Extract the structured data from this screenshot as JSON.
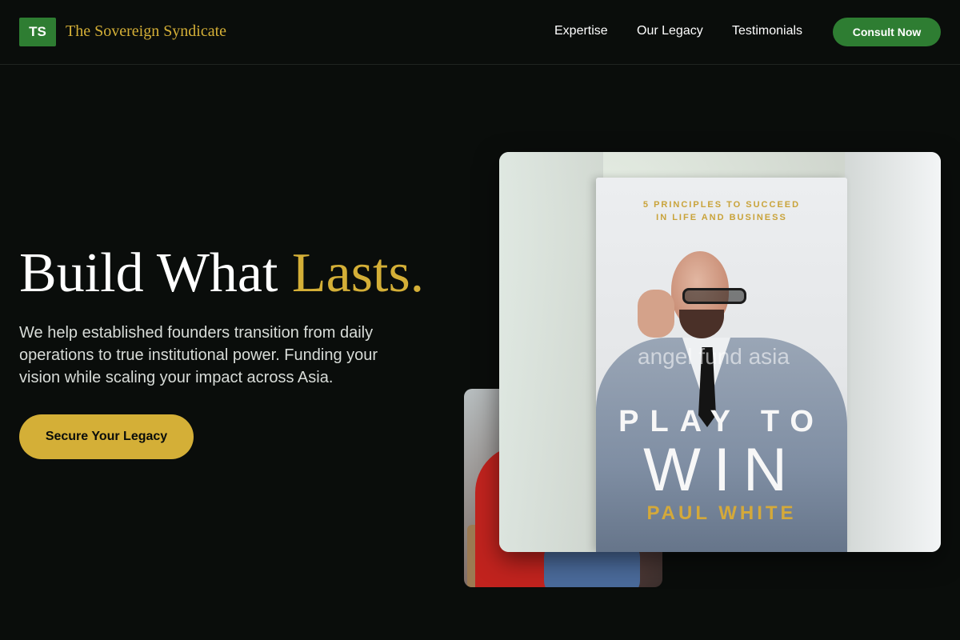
{
  "header": {
    "logo_initials": "TS",
    "brand_name": "The Sovereign Syndicate",
    "nav": [
      {
        "label": "Expertise"
      },
      {
        "label": "Our Legacy"
      },
      {
        "label": "Testimonials"
      }
    ],
    "cta_label": "Consult Now"
  },
  "hero": {
    "title_main": "Build What ",
    "title_accent": "Lasts.",
    "description": "We help established founders transition from daily operations to true institutional power. Funding your vision while scaling your impact across Asia.",
    "cta_label": "Secure Your Legacy"
  },
  "book": {
    "tagline_line1": "5 PRINCIPLES TO SUCCEED",
    "tagline_line2": "IN LIFE AND BUSINESS",
    "watermark": "angel fund asia",
    "title_line1": "PLAY TO",
    "title_line2": "WIN",
    "author": "PAUL WHITE"
  },
  "colors": {
    "background": "#0a0d0b",
    "brand_green": "#2e7d32",
    "gold_accent": "#d4af37"
  }
}
